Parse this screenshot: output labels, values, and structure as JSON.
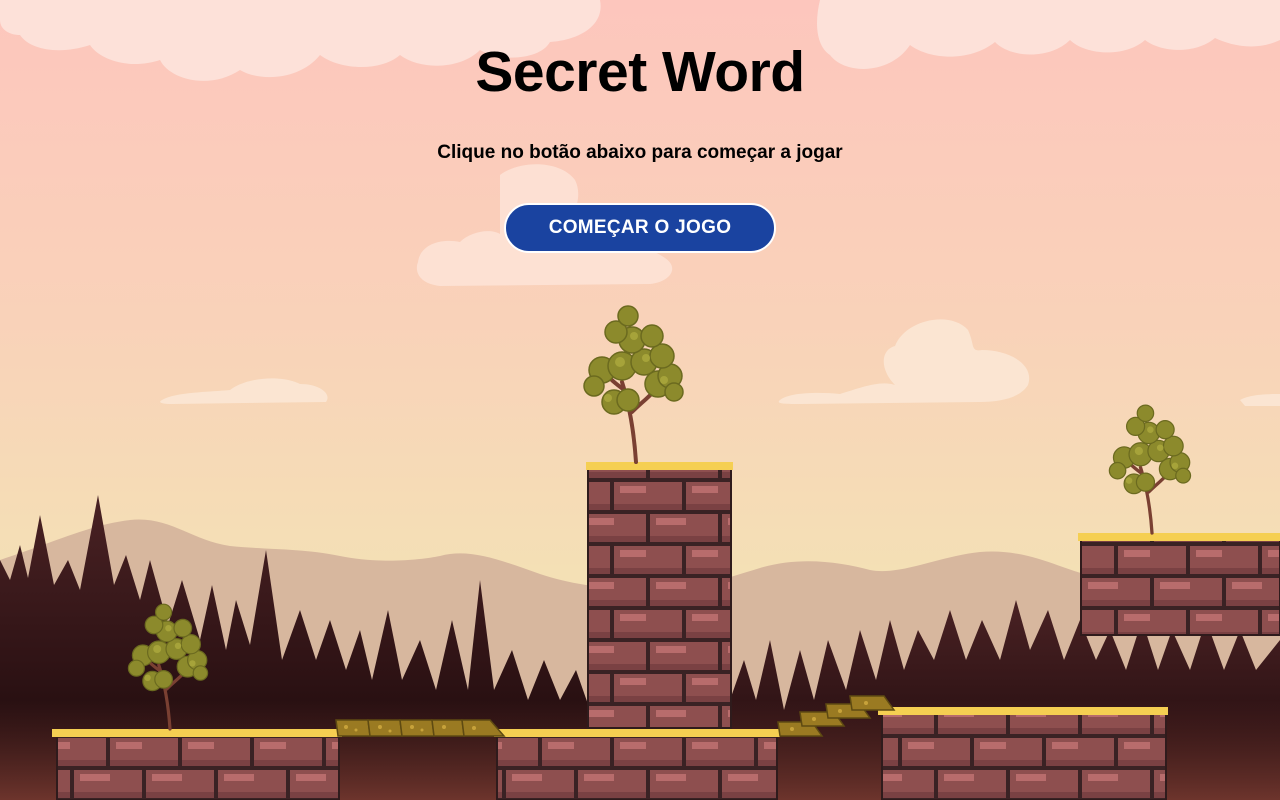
{
  "game": {
    "title": "Secret Word",
    "subtitle": "Clique no botão abaixo para começar a jogar",
    "start_button": "COMEÇAR O JOGO"
  },
  "colors": {
    "sky_top": "#fdc6bd",
    "sky_bottom": "#f5e2b5",
    "button": "#1a43a0",
    "brick": "#8e4f4f",
    "platform_top": "#f5cf52",
    "tree_foliage": "#8c8a2c",
    "forest": "#3c1a1c"
  }
}
